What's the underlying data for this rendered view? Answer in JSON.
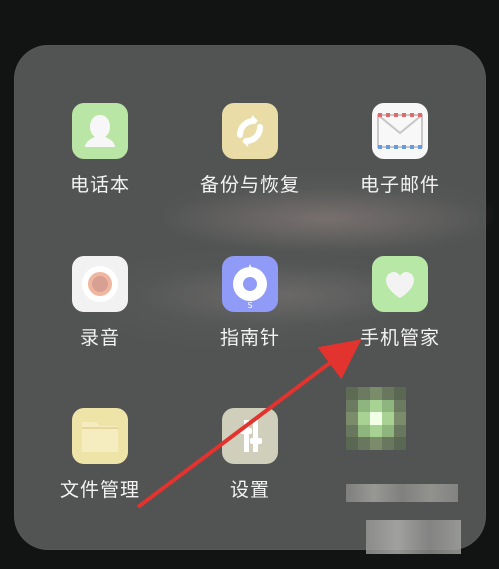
{
  "folder": {
    "apps": [
      {
        "label": "电话本",
        "icon": "phonebook-icon",
        "color": "#b9e6a5"
      },
      {
        "label": "备份与恢复",
        "icon": "backup-restore-icon",
        "color": "#eadca6"
      },
      {
        "label": "电子邮件",
        "icon": "mail-icon",
        "color": "#f7f7f7"
      },
      {
        "label": "录音",
        "icon": "recorder-icon",
        "color": "#f2f2f2"
      },
      {
        "label": "指南针",
        "icon": "compass-icon",
        "color": "#8f9bf7"
      },
      {
        "label": "手机管家",
        "icon": "phone-manager-icon",
        "color": "#b8e8a6"
      },
      {
        "label": "文件管理",
        "icon": "folder-icon",
        "color": "#efe4a8"
      },
      {
        "label": "设置",
        "icon": "settings-icon",
        "color": "#cfcfbc"
      }
    ]
  },
  "annotation": {
    "arrow_color": "#e2332e"
  }
}
